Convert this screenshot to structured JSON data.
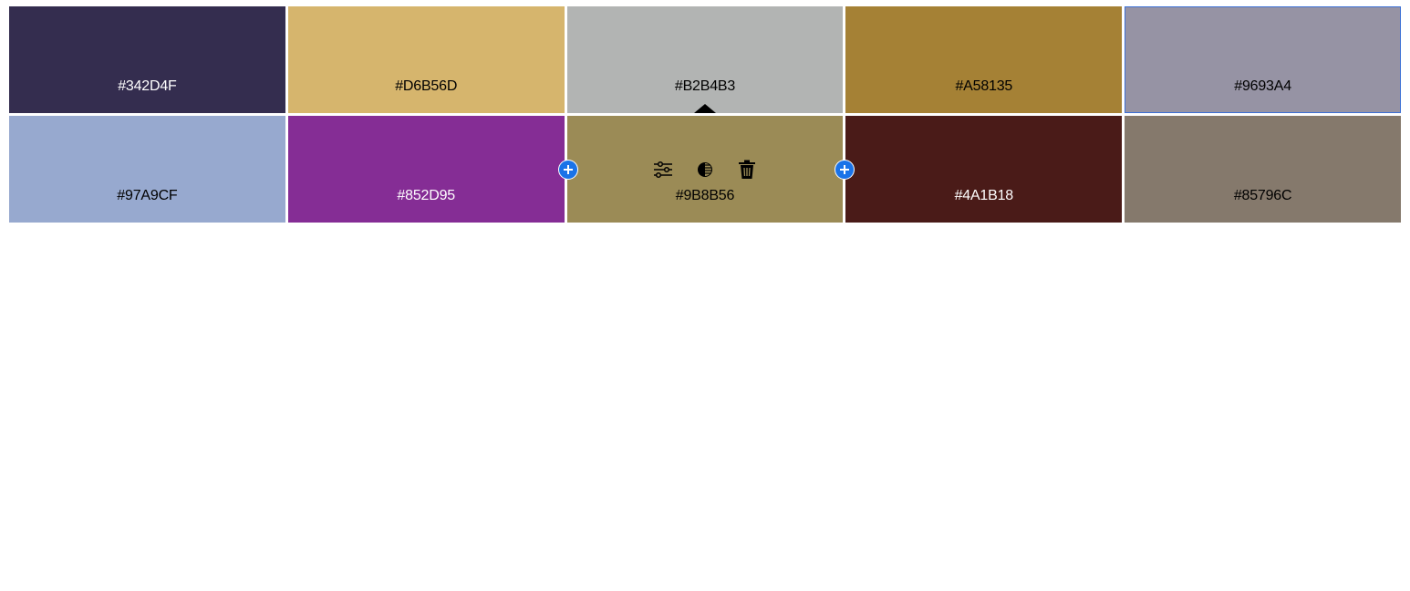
{
  "swatches": [
    {
      "hex": "#342D4F",
      "color": "#342D4F",
      "text_color": "#ffffff"
    },
    {
      "hex": "#D6B56D",
      "color": "#D6B56D",
      "text_color": "#000000"
    },
    {
      "hex": "#B2B4B3",
      "color": "#B2B4B3",
      "text_color": "#000000",
      "caret": true
    },
    {
      "hex": "#A58135",
      "color": "#A58135",
      "text_color": "#000000"
    },
    {
      "hex": "#9693A4",
      "color": "#9693A4",
      "text_color": "#000000",
      "selected": true
    },
    {
      "hex": "#97A9CF",
      "color": "#97A9CF",
      "text_color": "#000000"
    },
    {
      "hex": "#852D95",
      "color": "#852D95",
      "text_color": "#ffffff"
    },
    {
      "hex": "#9B8B56",
      "color": "#9B8B56",
      "text_color": "#000000",
      "active": true
    },
    {
      "hex": "#4A1B18",
      "color": "#4A1B18",
      "text_color": "#ffffff"
    },
    {
      "hex": "#85796C",
      "color": "#85796C",
      "text_color": "#000000"
    }
  ],
  "toolbar": {
    "icons": [
      "adjust-sliders-icon",
      "contrast-icon",
      "trash-icon"
    ]
  },
  "add_buttons": {
    "icon": "plus-circle-icon",
    "color": "#1a73e8"
  }
}
